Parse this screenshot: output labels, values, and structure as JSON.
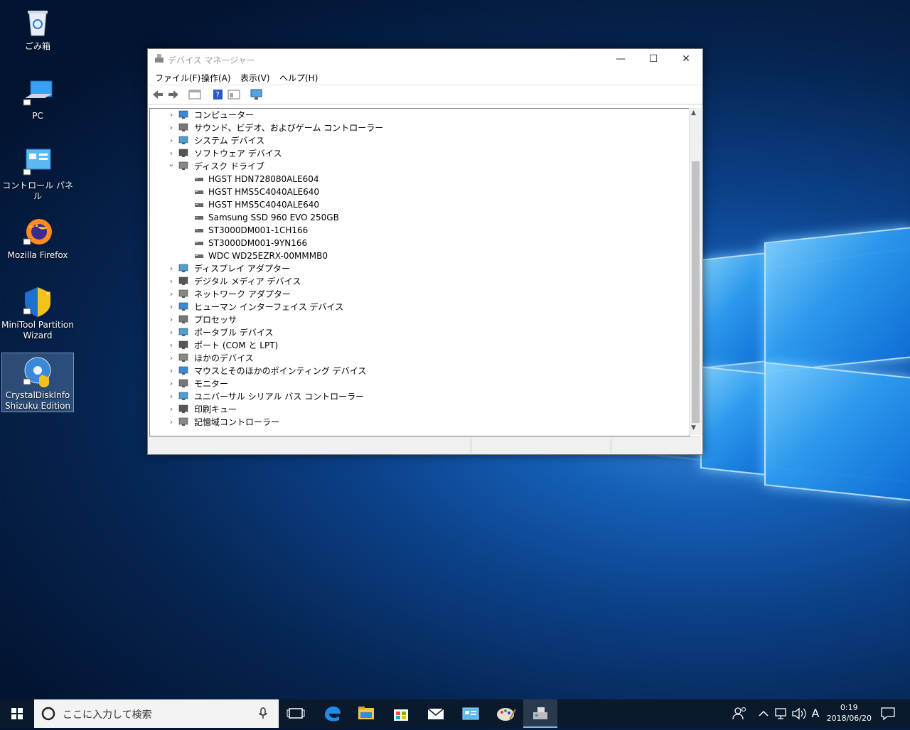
{
  "desktop": {
    "icons": [
      {
        "label": "ごみ箱"
      },
      {
        "label": "PC"
      },
      {
        "label": "コントロール パネル"
      },
      {
        "label": "Mozilla Firefox"
      },
      {
        "label": "MiniTool Partition Wizard"
      },
      {
        "label": "CrystalDiskInfo Shizuku Edition"
      }
    ]
  },
  "window": {
    "title": "デバイス マネージャー",
    "minimize": "—",
    "maximize": "☐",
    "close": "✕",
    "menu": [
      "ファイル(F)",
      "操作(A)",
      "表示(V)",
      "ヘルプ(H)"
    ]
  },
  "tree": [
    {
      "label": "コンピューター",
      "expanded": false
    },
    {
      "label": "サウンド、ビデオ、およびゲーム コントローラー",
      "expanded": false
    },
    {
      "label": "システム デバイス",
      "expanded": false
    },
    {
      "label": "ソフトウェア デバイス",
      "expanded": false
    },
    {
      "label": "ディスク ドライブ",
      "expanded": true
    },
    {
      "label": "HGST HDN728080ALE604",
      "child": true
    },
    {
      "label": "HGST HMS5C4040ALE640",
      "child": true
    },
    {
      "label": "HGST HMS5C4040ALE640",
      "child": true
    },
    {
      "label": "Samsung SSD 960 EVO 250GB",
      "child": true
    },
    {
      "label": "ST3000DM001-1CH166",
      "child": true
    },
    {
      "label": "ST3000DM001-9YN166",
      "child": true
    },
    {
      "label": "WDC WD25EZRX-00MMMB0",
      "child": true
    },
    {
      "label": "ディスプレイ アダプター",
      "expanded": false
    },
    {
      "label": "デジタル メディア デバイス",
      "expanded": false
    },
    {
      "label": "ネットワーク アダプター",
      "expanded": false
    },
    {
      "label": "ヒューマン インターフェイス デバイス",
      "expanded": false
    },
    {
      "label": "プロセッサ",
      "expanded": false
    },
    {
      "label": "ポータブル デバイス",
      "expanded": false
    },
    {
      "label": "ポート (COM と LPT)",
      "expanded": false
    },
    {
      "label": "ほかのデバイス",
      "expanded": false
    },
    {
      "label": "マウスとそのほかのポインティング デバイス",
      "expanded": false
    },
    {
      "label": "モニター",
      "expanded": false
    },
    {
      "label": "ユニバーサル シリアル バス コントローラー",
      "expanded": false
    },
    {
      "label": "印刷キュー",
      "expanded": false
    },
    {
      "label": "記憶域コントローラー",
      "expanded": false
    }
  ],
  "taskbar": {
    "search_placeholder": "ここに入力して検索",
    "ime": "A",
    "time": "0:19",
    "date": "2018/06/20"
  }
}
